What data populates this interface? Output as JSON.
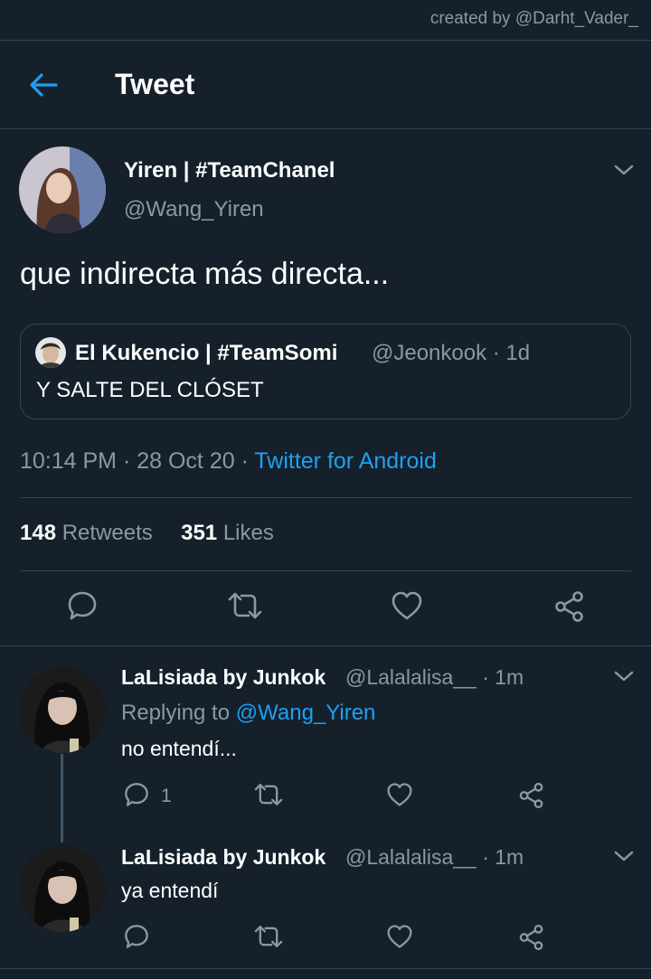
{
  "watermark": "created by @Darht_Vader_",
  "header": {
    "title": "Tweet",
    "back_icon": "arrow-left-icon"
  },
  "tweet": {
    "author_name": "Yiren | #TeamChanel",
    "author_handle": "@Wang_Yiren",
    "text": "que indirecta más directa...",
    "quote": {
      "author_name": "El Kukencio | #TeamSomi",
      "author_handle": "@Jeonkook · 1d",
      "text": "Y SALTE DEL CLÓSET"
    },
    "time": "10:14 PM · 28 Oct 20 · ",
    "source": "Twitter for Android",
    "retweets_count": "148",
    "retweets_label": " Retweets",
    "likes_count": "351",
    "likes_label": " Likes"
  },
  "replies": [
    {
      "author_name": "LaLisiada by Junkok",
      "author_handle": "@Lalalalisa__ · 1m",
      "replying_prefix": "Replying to ",
      "replying_mention": "@Wang_Yiren",
      "text": "no entendí...",
      "reply_count": "1"
    },
    {
      "author_name": "LaLisiada by Junkok",
      "author_handle": "@Lalalalisa__ · 1m",
      "text": "ya entendí"
    }
  ],
  "colors": {
    "background": "#15202b",
    "accent": "#1da1f2",
    "secondary_text": "#8899a6",
    "divider": "#38444d"
  }
}
